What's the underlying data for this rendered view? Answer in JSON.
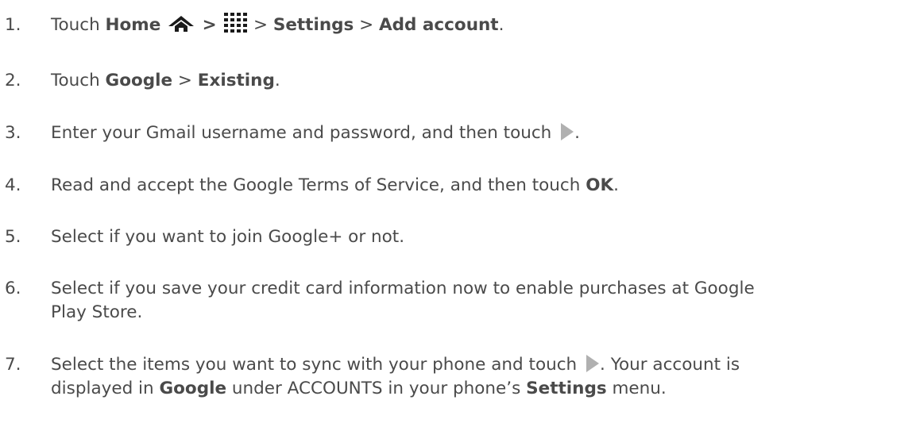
{
  "steps": [
    {
      "number": "1.",
      "t1": "Touch ",
      "home": "Home",
      "sep1": " > ",
      "sep2": " > ",
      "settings": "Settings",
      "sep3": " > ",
      "add_account": "Add account",
      "end": ".",
      "icons": [
        "home-icon",
        "apps-grid-icon"
      ]
    },
    {
      "number": "2.",
      "t1": "Touch ",
      "google": "Google",
      "sep": " > ",
      "existing": "Existing",
      "end": "."
    },
    {
      "number": "3.",
      "t1": "Enter your Gmail username and password, and then touch ",
      "end": ".",
      "icons": [
        "next-arrow-icon"
      ]
    },
    {
      "number": "4.",
      "t1": "Read and accept the Google Terms of Service, and then touch ",
      "ok": "OK",
      "end": "."
    },
    {
      "number": "5.",
      "t1": "Select if you want to join Google+ or not."
    },
    {
      "number": "6.",
      "line1": "Select if you save your credit card information now to enable purchases at Google",
      "line2": "Play Store."
    },
    {
      "number": "7.",
      "l1a": "Select the items you want to sync with your phone and touch ",
      "l1b": ". Your account is",
      "l2a": "displayed in ",
      "google": "Google",
      "l2b": " under ACCOUNTS in your phone’s ",
      "settings": "Settings",
      "l2c": " menu.",
      "icons": [
        "next-arrow-icon"
      ]
    }
  ],
  "colors": {
    "text": "#4a4a4a",
    "icon": "#1a1a1a",
    "play_icon": "#b0b0b0"
  }
}
